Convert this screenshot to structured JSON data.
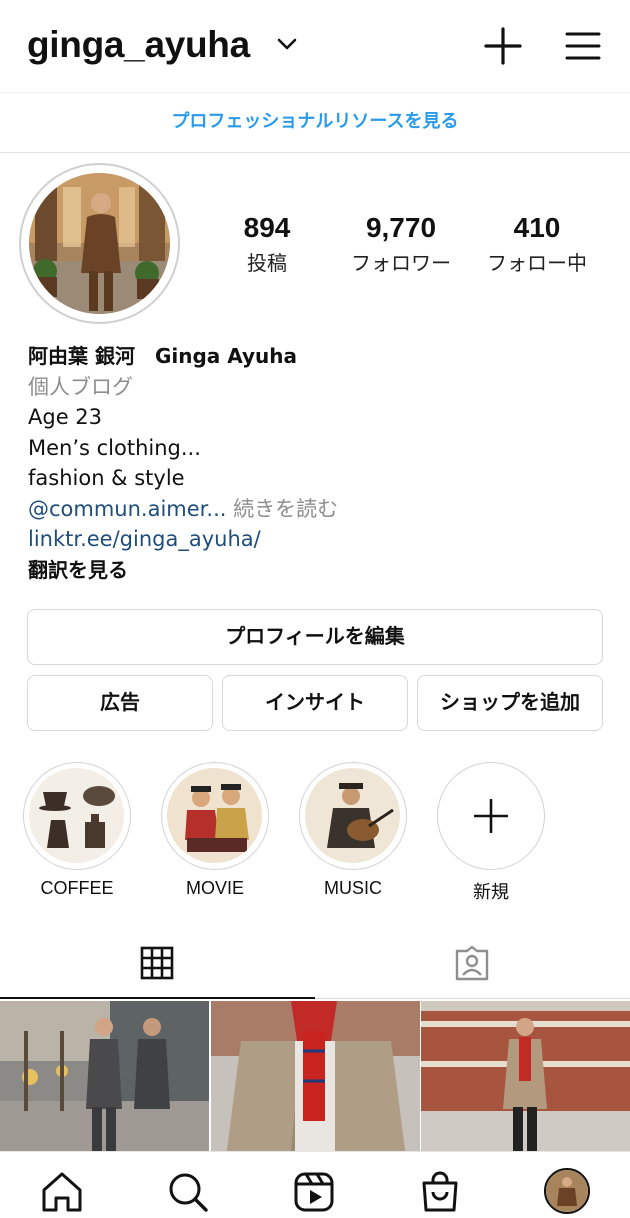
{
  "header": {
    "username": "ginga_ayuha",
    "icons": [
      "chevron-down-icon",
      "plus-icon",
      "hamburger-menu-icon"
    ]
  },
  "pro_banner": "プロフェッショナルリソースを見る",
  "profile": {
    "stats": [
      {
        "value": "894",
        "label": "投稿"
      },
      {
        "value": "9,770",
        "label": "フォロワー"
      },
      {
        "value": "410",
        "label": "フォロー中"
      }
    ],
    "name": "阿由葉 銀河　Ginga Ayuha",
    "category": "個人ブログ",
    "bio_lines": [
      "Age 23",
      "Men’s clothing...",
      "fashion & style"
    ],
    "mention": "@commun.aimer...",
    "read_more": "続きを読む",
    "link": "linktr.ee/ginga_ayuha/",
    "translate": "翻訳を見る"
  },
  "buttons": {
    "edit_profile": "プロフィールを編集",
    "ads": "広告",
    "insights": "インサイト",
    "add_shop": "ショップを追加"
  },
  "highlights": [
    {
      "label": "COFFEE"
    },
    {
      "label": "MOVIE"
    },
    {
      "label": "MUSIC"
    },
    {
      "label": "新規"
    }
  ],
  "tabs": [
    "grid-icon",
    "tagged-icon"
  ],
  "nav": [
    "home-icon",
    "search-icon",
    "reels-icon",
    "shop-icon",
    "profile-avatar"
  ],
  "colors": {
    "accent_blue": "#2a9be8",
    "link_blue": "#1f4e7c",
    "muted": "#8e8e8e"
  }
}
